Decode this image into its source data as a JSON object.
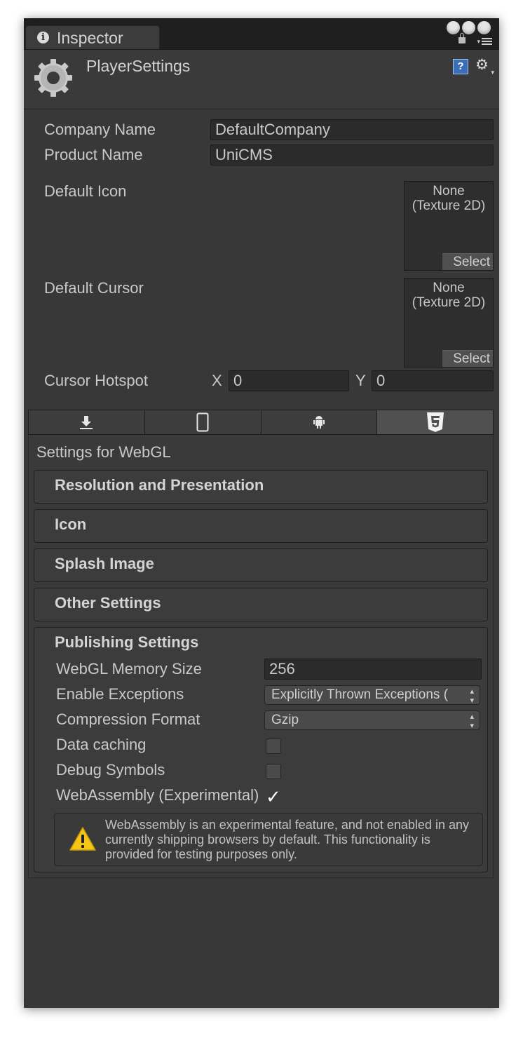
{
  "tab": {
    "title": "Inspector"
  },
  "header": {
    "title": "PlayerSettings"
  },
  "general": {
    "company_name_label": "Company Name",
    "company_name_value": "DefaultCompany",
    "product_name_label": "Product Name",
    "product_name_value": "UniCMS",
    "default_icon_label": "Default Icon",
    "default_cursor_label": "Default Cursor",
    "texture_none": "None",
    "texture_type": "(Texture 2D)",
    "select_label": "Select",
    "cursor_hotspot_label": "Cursor Hotspot",
    "x_label": "X",
    "x_value": "0",
    "y_label": "Y",
    "y_value": "0"
  },
  "platform_tabs": [
    {
      "name": "standalone",
      "icon": "download-icon",
      "selected": false
    },
    {
      "name": "ios",
      "icon": "phone-icon",
      "selected": false
    },
    {
      "name": "android",
      "icon": "android-icon",
      "selected": false
    },
    {
      "name": "webgl",
      "icon": "html5-icon",
      "selected": true
    }
  ],
  "platform": {
    "settings_for": "Settings for WebGL",
    "sections": [
      "Resolution and Presentation",
      "Icon",
      "Splash Image",
      "Other Settings"
    ]
  },
  "publishing": {
    "title": "Publishing Settings",
    "memory_label": "WebGL Memory Size",
    "memory_value": "256",
    "exceptions_label": "Enable Exceptions",
    "exceptions_value": "Explicitly Thrown Exceptions (",
    "compression_label": "Compression Format",
    "compression_value": "Gzip",
    "data_caching_label": "Data caching",
    "data_caching_checked": false,
    "debug_symbols_label": "Debug Symbols",
    "debug_symbols_checked": false,
    "wasm_label": "WebAssembly (Experimental)",
    "wasm_checked": true,
    "warning_text": "WebAssembly is an experimental feature, and not enabled in any currently shipping browsers by default. This functionality is provided for testing purposes only."
  }
}
